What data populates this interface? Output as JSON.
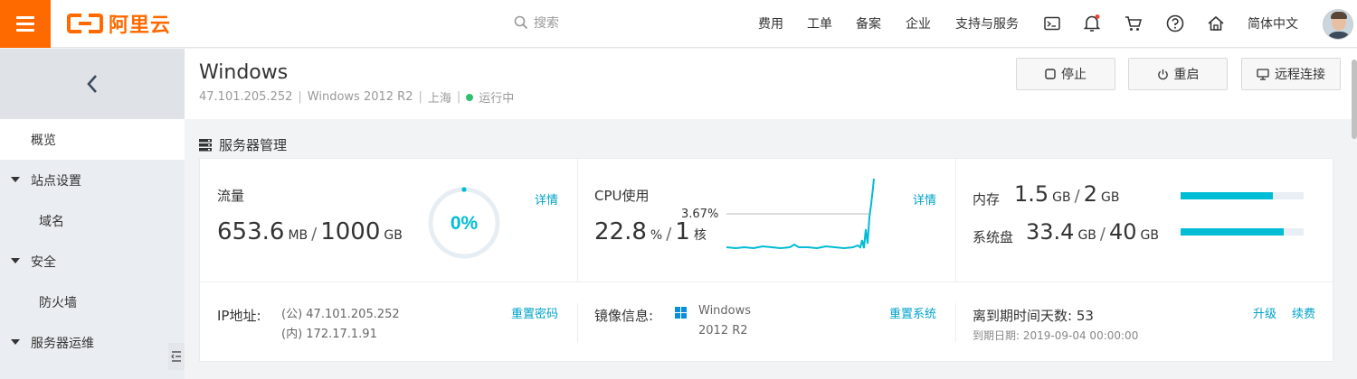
{
  "topbar": {
    "logo_text": "阿里云",
    "search_placeholder": "搜索",
    "nav": [
      "费用",
      "工单",
      "备案",
      "企业",
      "支持与服务"
    ],
    "language": "简体中文",
    "icons": [
      "terminal-icon",
      "bell-icon",
      "cart-icon",
      "help-icon",
      "home-icon"
    ]
  },
  "sidebar": {
    "items": [
      {
        "label": "概览",
        "active": true,
        "expandable": false
      },
      {
        "label": "站点设置",
        "active": false,
        "expandable": true
      },
      {
        "label": "域名",
        "active": false,
        "expandable": false
      },
      {
        "label": "安全",
        "active": false,
        "expandable": true
      },
      {
        "label": "防火墙",
        "active": false,
        "expandable": false
      },
      {
        "label": "服务器运维",
        "active": false,
        "expandable": true
      }
    ]
  },
  "header": {
    "title": "Windows",
    "ip": "47.101.205.252",
    "os": "Windows 2012 R2",
    "region": "上海",
    "status": "运行中",
    "buttons": {
      "stop": "停止",
      "restart": "重启",
      "remote": "远程连接"
    }
  },
  "section": {
    "title": "服务器管理"
  },
  "traffic": {
    "label": "流量",
    "used": "653.6",
    "used_unit": "MB",
    "total": "1000",
    "total_unit": "GB",
    "percent_text": "0%",
    "percent": 0.0,
    "detail": "详情"
  },
  "cpu": {
    "label": "CPU使用",
    "value": "22.8",
    "value_unit": "%",
    "cores": "1",
    "cores_unit": "核",
    "peak": "3.67%",
    "detail": "详情"
  },
  "memory": {
    "label": "内存",
    "used": "1.5",
    "unit": "GB",
    "total": "2",
    "total_unit": "GB",
    "fraction": 0.75
  },
  "disk": {
    "label": "系统盘",
    "used": "33.4",
    "unit": "GB",
    "total": "40",
    "total_unit": "GB",
    "fraction": 0.835
  },
  "ip_info": {
    "label": "IP地址:",
    "public": "(公) 47.101.205.252",
    "private": "(内) 172.17.1.91",
    "action": "重置密码"
  },
  "image_info": {
    "label": "镜像信息:",
    "line1": "Windows",
    "line2": "2012 R2",
    "action": "重置系统"
  },
  "expiry": {
    "label": "离到期时间天数:",
    "days": "53",
    "date_label": "到期日期:",
    "date": "2019-09-04 00:00:00",
    "upgrade": "升级",
    "renew": "续费"
  },
  "colors": {
    "brand": "#ff6a00",
    "accent": "#00bcd4",
    "link": "#00a2ca",
    "status_ok": "#2fbf71"
  }
}
